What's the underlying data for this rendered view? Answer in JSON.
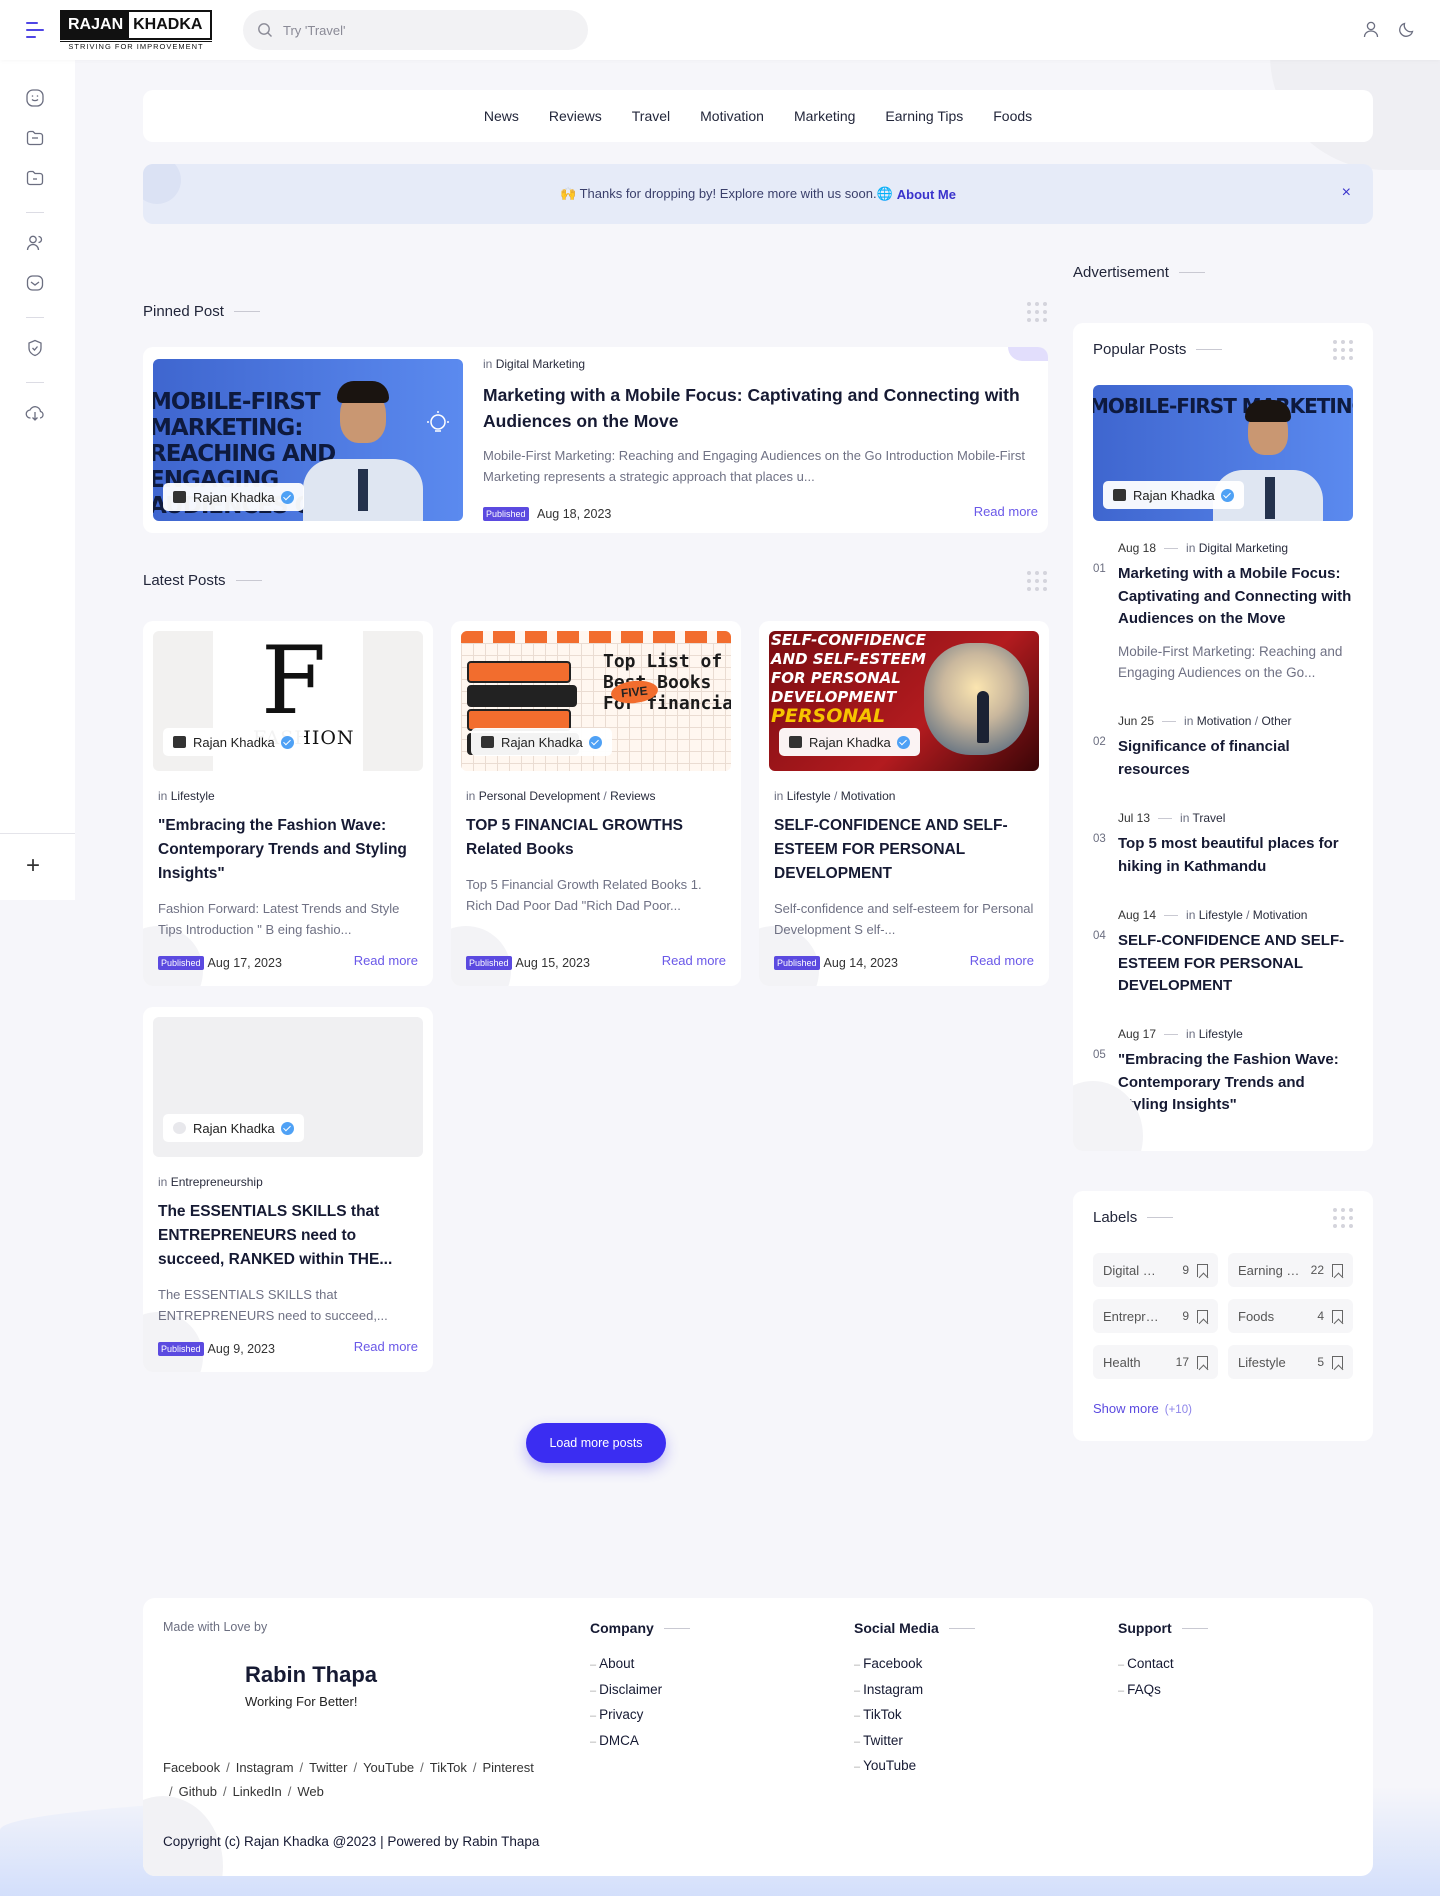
{
  "header": {
    "logo_left": "RAJAN",
    "logo_right": "KHADKA",
    "logo_tagline": "STRIVING FOR IMPROVEMENT",
    "search_placeholder": "Try 'Travel'"
  },
  "nav": [
    "News",
    "Reviews",
    "Travel",
    "Motivation",
    "Marketing",
    "Earning Tips",
    "Foods"
  ],
  "notice": {
    "text": "🙌 Thanks for dropping by! Explore more with us soon.🌐",
    "link": "About Me",
    "close": "×"
  },
  "pinned": {
    "section_title": "Pinned Post",
    "in": "in",
    "category": "Digital Marketing",
    "title": "Marketing with a Mobile Focus: Captivating and Connecting with Audiences on the Move",
    "excerpt": "Mobile-First Marketing: Reaching and Engaging Audiences on the Go  Introduction Mobile-First Marketing represents a strategic approach that places u...",
    "badge": "Published",
    "date": "Aug 18, 2023",
    "read_more": "Read more",
    "author": "Rajan Khadka",
    "image_text": "MOBILE-FIRST\nMARKETING:\nREACHING AND\nENGAGING\nAUDIENCES ON"
  },
  "latest": {
    "section_title": "Latest Posts",
    "posts": [
      {
        "categories": [
          "Lifestyle"
        ],
        "title": "\"Embracing the Fashion Wave: Contemporary Trends and Styling Insights\"",
        "excerpt": "Fashion Forward: Latest Trends and Style Tips  Introduction \" B eing fashio...",
        "badge": "Published",
        "date": "Aug 17, 2023",
        "read_more": "Read more",
        "author": "Rajan Khadka",
        "image_text": "FASHION\nFORWARD"
      },
      {
        "categories": [
          "Personal Development",
          "Reviews"
        ],
        "title": "TOP 5 FINANCIAL GROWTHS Related Books",
        "excerpt": "Top 5 Financial Growth Related Books 1. Rich Dad Poor Dad  \"Rich Dad Poor...",
        "badge": "Published",
        "date": "Aug 15, 2023",
        "read_more": "Read more",
        "author": "Rajan Khadka",
        "image_text": "Top List of\nBest Books\nFor financial growth",
        "image_badge": "FIVE"
      },
      {
        "categories": [
          "Lifestyle",
          "Motivation"
        ],
        "title": "SELF-CONFIDENCE AND SELF-ESTEEM FOR PERSONAL DEVELOPMENT",
        "excerpt": "Self-confidence and self-esteem for Personal Development   S elf-...",
        "badge": "Published",
        "date": "Aug 14, 2023",
        "read_more": "Read more",
        "author": "Rajan Khadka",
        "image_text": "SELF-CONFIDENCE\nAND SELF-ESTEEM\nFOR PERSONAL\nDEVELOPMENT",
        "image_text2": "PERSONAL",
        "image_text3": "DEVELOPMENT"
      },
      {
        "categories": [
          "Entrepreneurship"
        ],
        "title": "The ESSENTIALS SKILLS that ENTREPRENEURS need to succeed, RANKED within THE...",
        "excerpt": "The ESSENTIALS SKILLS that ENTREPRENEURS need to succeed,...",
        "badge": "Published",
        "date": "Aug 9, 2023",
        "read_more": "Read more",
        "author": "Rajan Khadka"
      }
    ],
    "load_more": "Load more posts"
  },
  "sidebar_right": {
    "advertisement": "Advertisement",
    "popular_title": "Popular Posts",
    "popular_author": "Rajan Khadka",
    "popular": [
      {
        "num": "01",
        "date": "Aug 18",
        "categories": [
          "Digital Marketing"
        ],
        "title": "Marketing with a Mobile Focus: Captivating and Connecting with Audiences on the Move",
        "excerpt": "Mobile-First Marketing: Reaching and Engaging Audiences on the Go..."
      },
      {
        "num": "02",
        "date": "Jun 25",
        "categories": [
          "Motivation",
          "Other"
        ],
        "title": "Significance of financial resources"
      },
      {
        "num": "03",
        "date": "Jul 13",
        "categories": [
          "Travel"
        ],
        "title": "Top 5 most beautiful places for hiking in Kathmandu"
      },
      {
        "num": "04",
        "date": "Aug 14",
        "categories": [
          "Lifestyle",
          "Motivation"
        ],
        "title": "SELF-CONFIDENCE AND SELF-ESTEEM FOR PERSONAL DEVELOPMENT"
      },
      {
        "num": "05",
        "date": "Aug 17",
        "categories": [
          "Lifestyle"
        ],
        "title": "\"Embracing the Fashion Wave: Contemporary Trends and Styling Insights\""
      }
    ],
    "labels_title": "Labels",
    "labels": [
      {
        "name": "Digital Marketing",
        "count": "9"
      },
      {
        "name": "Earning tips",
        "count": "22"
      },
      {
        "name": "Entrepreneurship",
        "count": "9"
      },
      {
        "name": "Foods",
        "count": "4"
      },
      {
        "name": "Health",
        "count": "17"
      },
      {
        "name": "Lifestyle",
        "count": "5"
      }
    ],
    "show_more": "Show more",
    "show_more_count": "(+10)"
  },
  "footer": {
    "made_with": "Made with Love by",
    "name": "Rabin Thapa",
    "subtitle": "Working For Better!",
    "social_links": [
      "Facebook",
      "Instagram",
      "Twitter",
      "YouTube",
      "TikTok",
      "Pinterest",
      "Github",
      "LinkedIn",
      "Web"
    ],
    "columns": [
      {
        "title": "Company",
        "links": [
          "About",
          "Disclaimer",
          "Privacy",
          "DMCA"
        ]
      },
      {
        "title": "Social Media",
        "links": [
          "Facebook",
          "Instagram",
          "TikTok",
          "Twitter",
          "YouTube"
        ]
      },
      {
        "title": "Support",
        "links": [
          "Contact",
          "FAQs"
        ]
      }
    ],
    "copyright": "Copyright (c) Rajan Khadka @2023 | Powered by Rabin Thapa"
  },
  "colors": {
    "accent": "#3b2df2",
    "badge": "#5b4ae0",
    "notice_bg": "#e6ebf8",
    "verified": "#4fa1f5"
  }
}
